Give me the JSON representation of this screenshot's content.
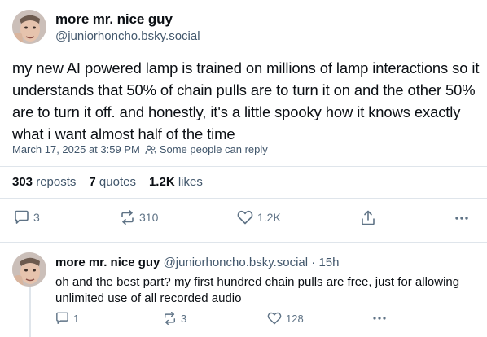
{
  "post": {
    "author_name": "more mr. nice guy",
    "author_handle": "@juniorhoncho.bsky.social",
    "text": "my new AI powered lamp is trained on millions of lamp interactions so it understands that 50% of chain pulls are to turn it on and the other 50% are to turn it off. and honestly, it's a little spooky how it knows exactly what i want almost half of the time",
    "timestamp": "March 17, 2025 at 3:59 PM",
    "reply_setting": "Some people can reply",
    "stats": {
      "reposts_count": "303",
      "reposts_label": "reposts",
      "quotes_count": "7",
      "quotes_label": "quotes",
      "likes_count": "1.2K",
      "likes_label": "likes"
    },
    "actions": {
      "reply_count": "3",
      "repost_count": "310",
      "like_count": "1.2K",
      "reply_icon": "speech-bubble-icon",
      "repost_icon": "repost-icon",
      "like_icon": "heart-icon",
      "share_icon": "share-icon",
      "more_icon": "ellipsis-icon"
    }
  },
  "reply": {
    "author_name": "more mr. nice guy",
    "author_handle": "@juniorhoncho.bsky.social",
    "age": "· 15h",
    "text": "oh and the best part? my first hundred chain pulls are free, just for allowing unlimited use of all recorded audio",
    "actions": {
      "reply_count": "1",
      "repost_count": "3",
      "like_count": "128"
    }
  },
  "colors": {
    "text": "#0b0f14",
    "muted": "#42576c",
    "icon": "#5f7386",
    "divider": "#dfe5eb"
  }
}
